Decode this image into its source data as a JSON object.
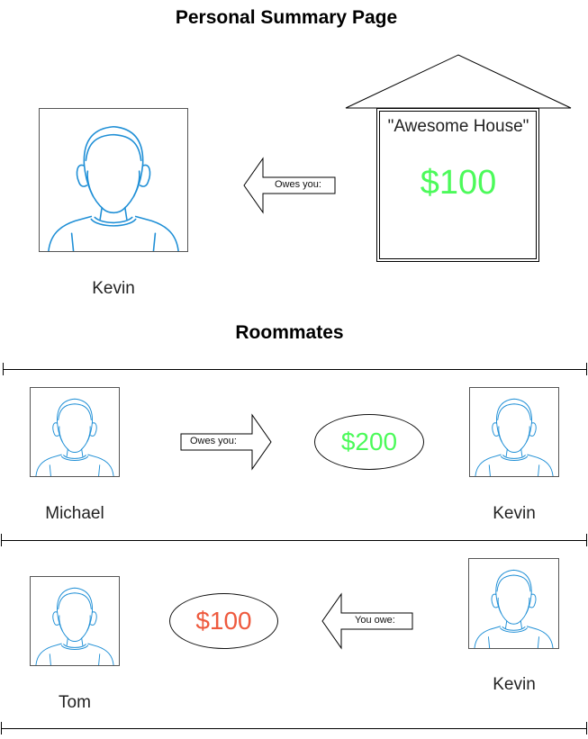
{
  "page_title": "Personal Summary Page",
  "colors": {
    "positive": "#4cfa5a",
    "negative": "#ee5a3e",
    "avatar_stroke": "#1f8fd6"
  },
  "summary": {
    "person_name": "Kevin",
    "arrow_label": "Owes you:",
    "house_name": "\"Awesome House\"",
    "house_amount": "$100"
  },
  "roommates_heading": "Roommates",
  "rows": [
    {
      "left_name": "Michael",
      "arrow_label": "Owes you:",
      "amount": "$200",
      "right_name": "Kevin"
    },
    {
      "left_name": "Tom",
      "arrow_label": "You owe:",
      "amount": "$100",
      "right_name": "Kevin"
    }
  ]
}
